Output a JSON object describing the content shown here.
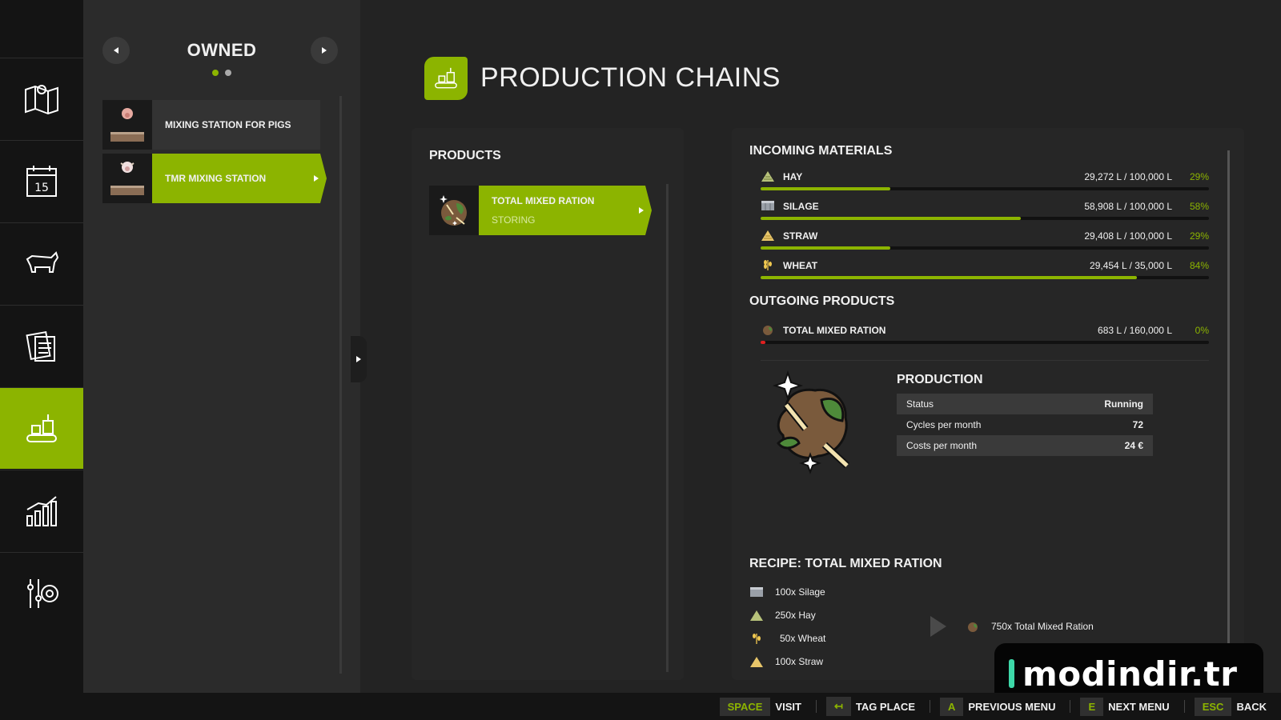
{
  "owned": {
    "title": "OWNED",
    "stations": [
      {
        "label": "MIXING STATION FOR PIGS"
      },
      {
        "label": "TMR MIXING STATION"
      }
    ]
  },
  "header": {
    "title": "PRODUCTION CHAINS"
  },
  "products": {
    "heading": "PRODUCTS",
    "items": [
      {
        "name": "TOTAL MIXED RATION",
        "status": "STORING"
      }
    ]
  },
  "incoming": {
    "heading": "INCOMING MATERIALS",
    "items": [
      {
        "name": "HAY",
        "amount": "29,272 L / 100,000 L",
        "pct": "29%",
        "fill": 0.29,
        "icon": "hay-icon"
      },
      {
        "name": "SILAGE",
        "amount": "58,908 L / 100,000 L",
        "pct": "58%",
        "fill": 0.58,
        "icon": "silage-icon"
      },
      {
        "name": "STRAW",
        "amount": "29,408 L / 100,000 L",
        "pct": "29%",
        "fill": 0.29,
        "icon": "straw-icon"
      },
      {
        "name": "WHEAT",
        "amount": "29,454 L / 35,000 L",
        "pct": "84%",
        "fill": 0.84,
        "icon": "wheat-icon"
      }
    ]
  },
  "outgoing": {
    "heading": "OUTGOING PRODUCTS",
    "items": [
      {
        "name": "TOTAL MIXED RATION",
        "amount": "683 L / 160,000 L",
        "pct": "0%",
        "fill": 0.0,
        "icon": "tmr-icon"
      }
    ]
  },
  "production": {
    "heading": "PRODUCTION",
    "rows": [
      {
        "label": "Status",
        "value": "Running"
      },
      {
        "label": "Cycles per month",
        "value": "72"
      },
      {
        "label": "Costs per month",
        "value": "24 €"
      }
    ]
  },
  "recipe": {
    "heading": "RECIPE: TOTAL MIXED RATION",
    "inputs": [
      "100x Silage",
      "250x Hay",
      "50x Wheat",
      "100x Straw"
    ],
    "output": "750x Total Mixed Ration"
  },
  "footer": {
    "actions": [
      {
        "key": "SPACE",
        "label": "VISIT"
      },
      {
        "key": "↤",
        "label": "TAG PLACE"
      },
      {
        "key": "A",
        "label": "PREVIOUS MENU"
      },
      {
        "key": "E",
        "label": "NEXT MENU"
      },
      {
        "key": "ESC",
        "label": "BACK"
      }
    ]
  },
  "watermark": {
    "text": "modindir.tr"
  },
  "colors": {
    "accent": "#8cb400",
    "bg": "#232323",
    "rail": "#141414",
    "critical": "#e02020"
  }
}
